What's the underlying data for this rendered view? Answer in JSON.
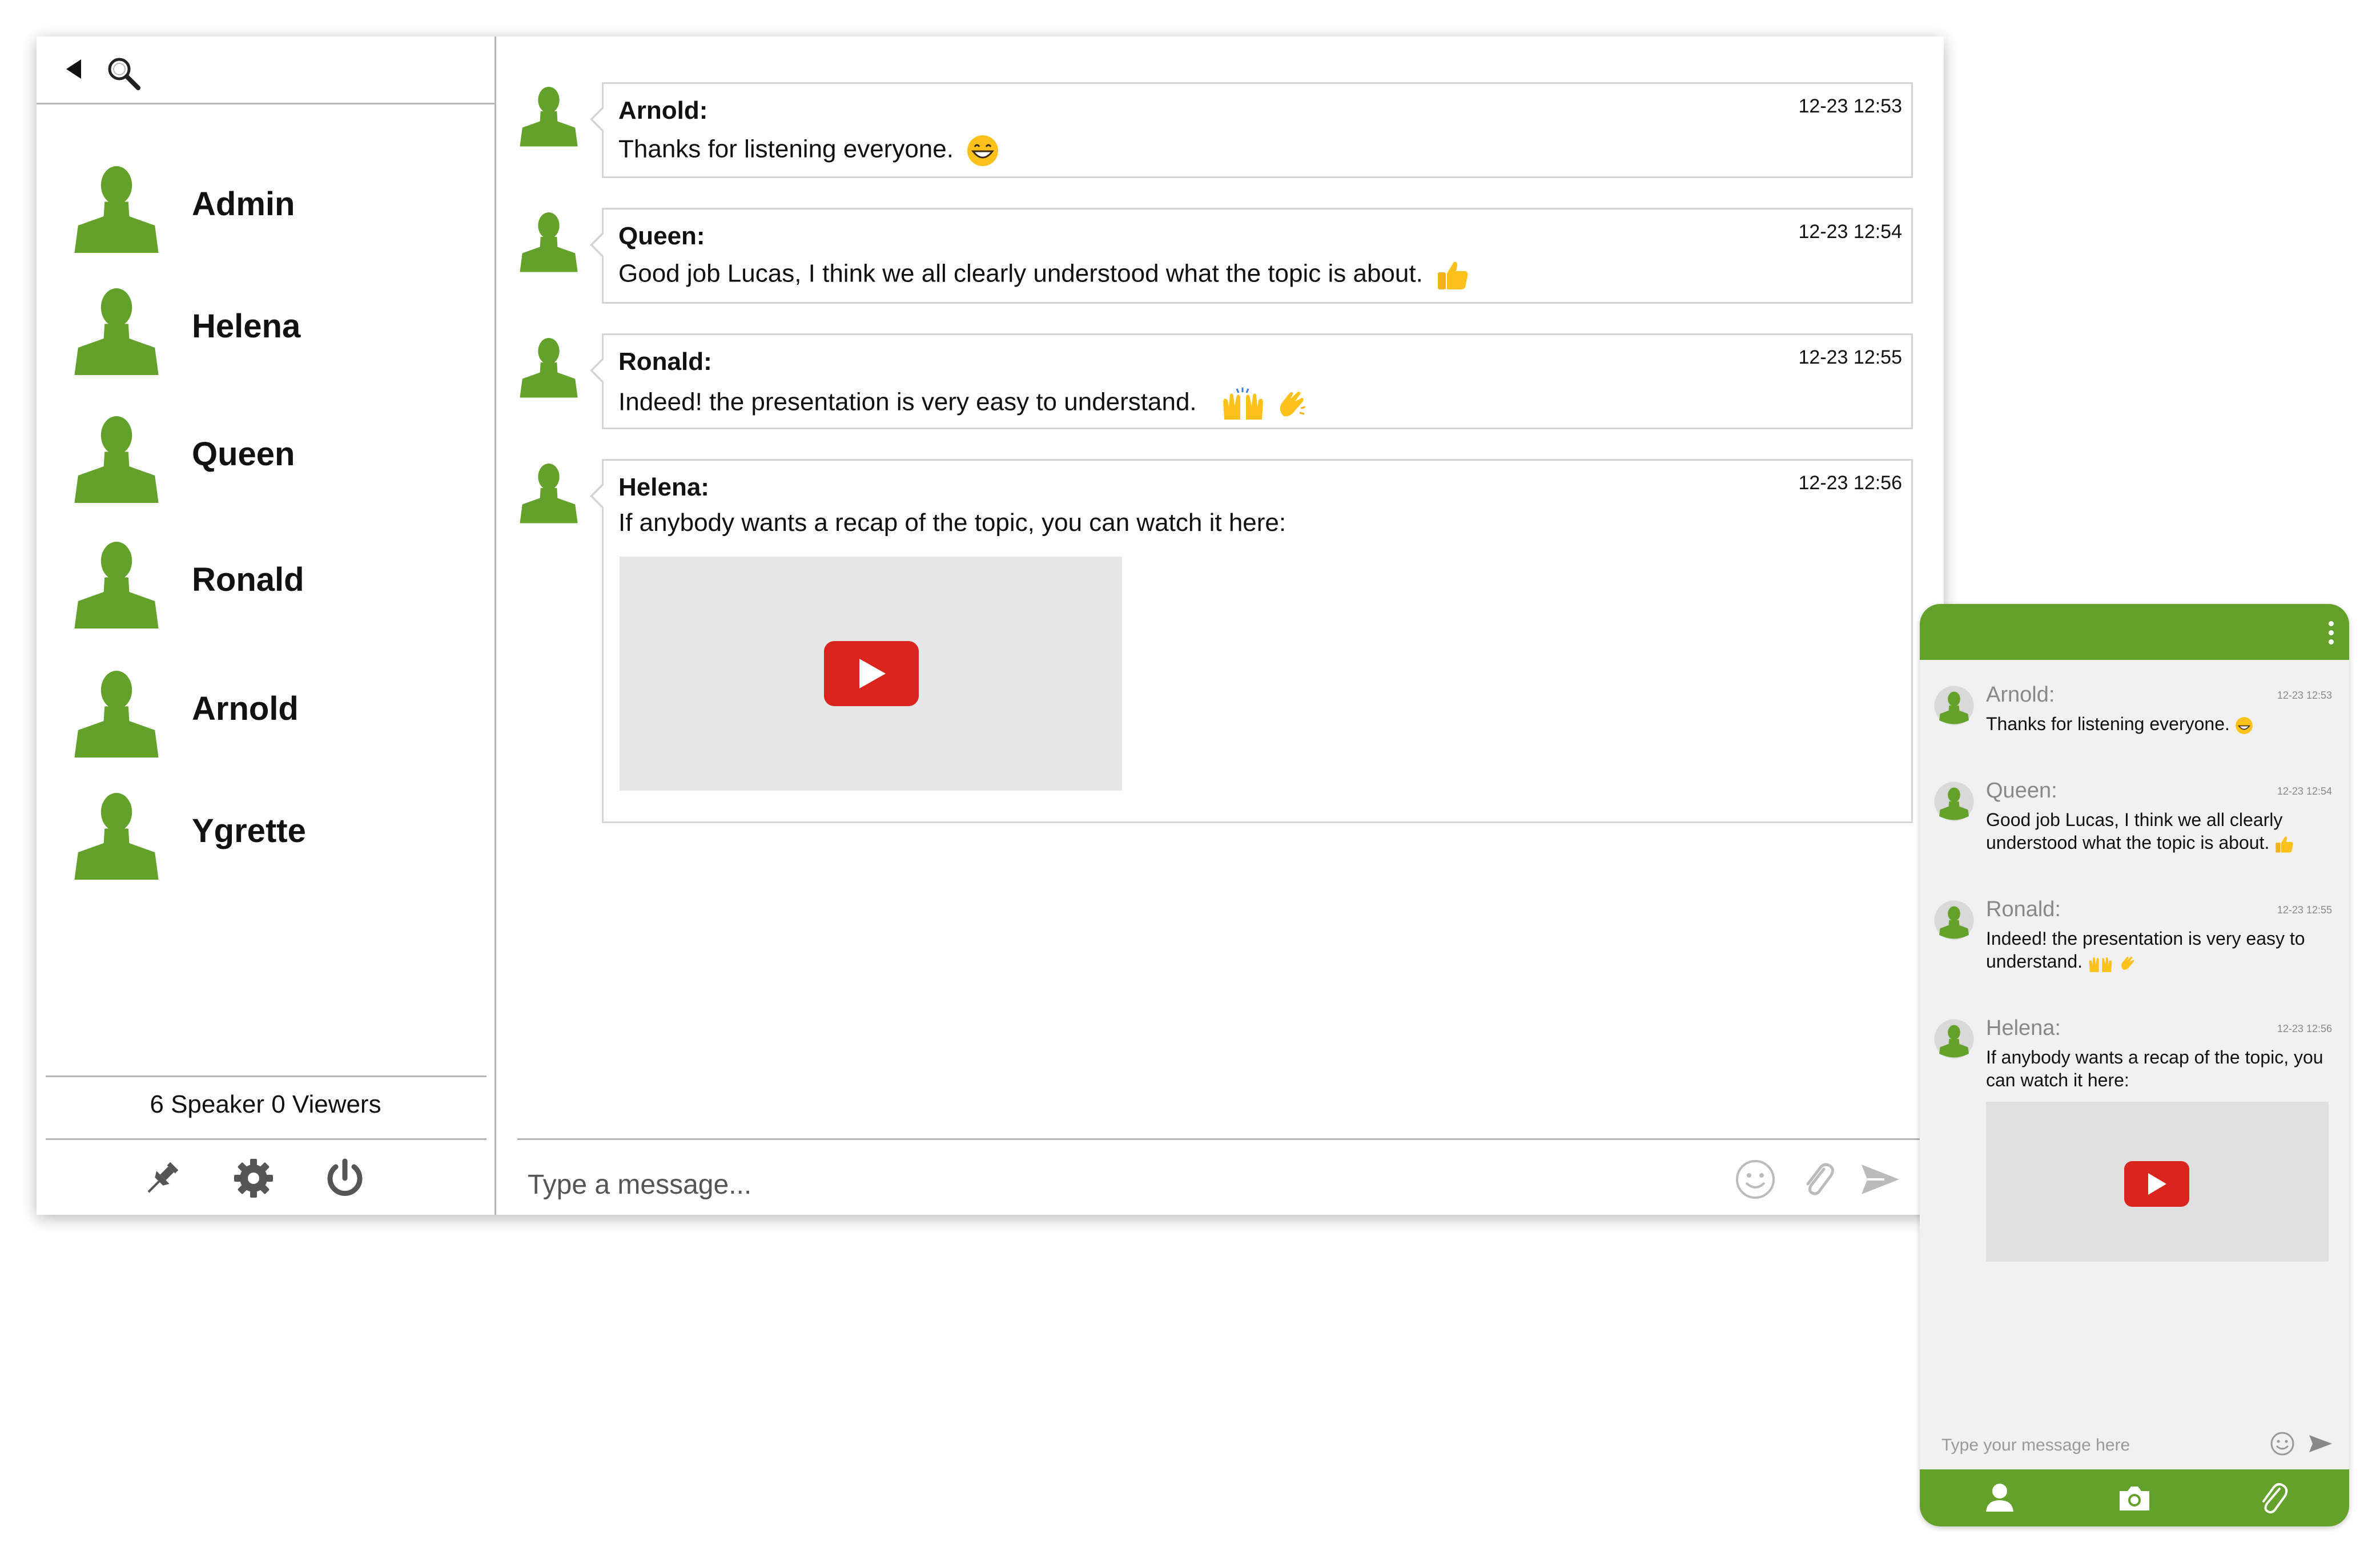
{
  "colors": {
    "brand_green": "#63a12b",
    "play_red": "#d9251d",
    "border": "#b5b5b5"
  },
  "sidebar": {
    "icons": [
      "back-arrow-icon",
      "search-icon"
    ],
    "contacts": [
      {
        "name": "Admin"
      },
      {
        "name": "Helena"
      },
      {
        "name": "Queen"
      },
      {
        "name": "Ronald"
      },
      {
        "name": "Arnold"
      },
      {
        "name": "Ygrette"
      }
    ],
    "viewers_text": "6 Speaker 0 Viewers",
    "footer_icons": [
      "pin-icon",
      "gear-icon",
      "power-icon"
    ]
  },
  "chat": {
    "messages": [
      {
        "author": "Arnold:",
        "time": "12-23 12:53",
        "text": "Thanks for listening everyone.",
        "emoji": [
          "grinning-face-icon"
        ]
      },
      {
        "author": "Queen:",
        "time": "12-23 12:54",
        "text": "Good job Lucas, I think we all clearly understood what the topic is about.",
        "emoji": [
          "thumbs-up-icon"
        ]
      },
      {
        "author": "Ronald:",
        "time": "12-23 12:55",
        "text": "Indeed! the presentation is very easy to understand.",
        "emoji": [
          "raised-hands-icon",
          "clapping-hands-icon"
        ]
      },
      {
        "author": "Helena:",
        "time": "12-23 12:56",
        "text": "If anybody wants a recap of the topic, you can watch it here:",
        "attachment": "video"
      }
    ],
    "input_placeholder": "Type a message...",
    "input_icons": [
      "smiley-icon",
      "paperclip-icon",
      "send-icon"
    ]
  },
  "mobile": {
    "menu_icon": "kebab-menu-icon",
    "messages": [
      {
        "author": "Arnold:",
        "time": "12-23 12:53",
        "text": "Thanks for listening everyone."
      },
      {
        "author": "Queen:",
        "time": "12-23 12:54",
        "text": "Good job Lucas, I think we all clearly understood what the topic is about."
      },
      {
        "author": "Ronald:",
        "time": "12-23 12:55",
        "text": "Indeed! the presentation is very easy to understand."
      },
      {
        "author": "Helena:",
        "time": "12-23 12:56",
        "text": "If anybody wants a recap of the topic, you can watch it here:"
      }
    ],
    "input_placeholder": "Type your message here",
    "footer_icons": [
      "user-icon",
      "camera-icon",
      "paperclip-icon"
    ]
  }
}
